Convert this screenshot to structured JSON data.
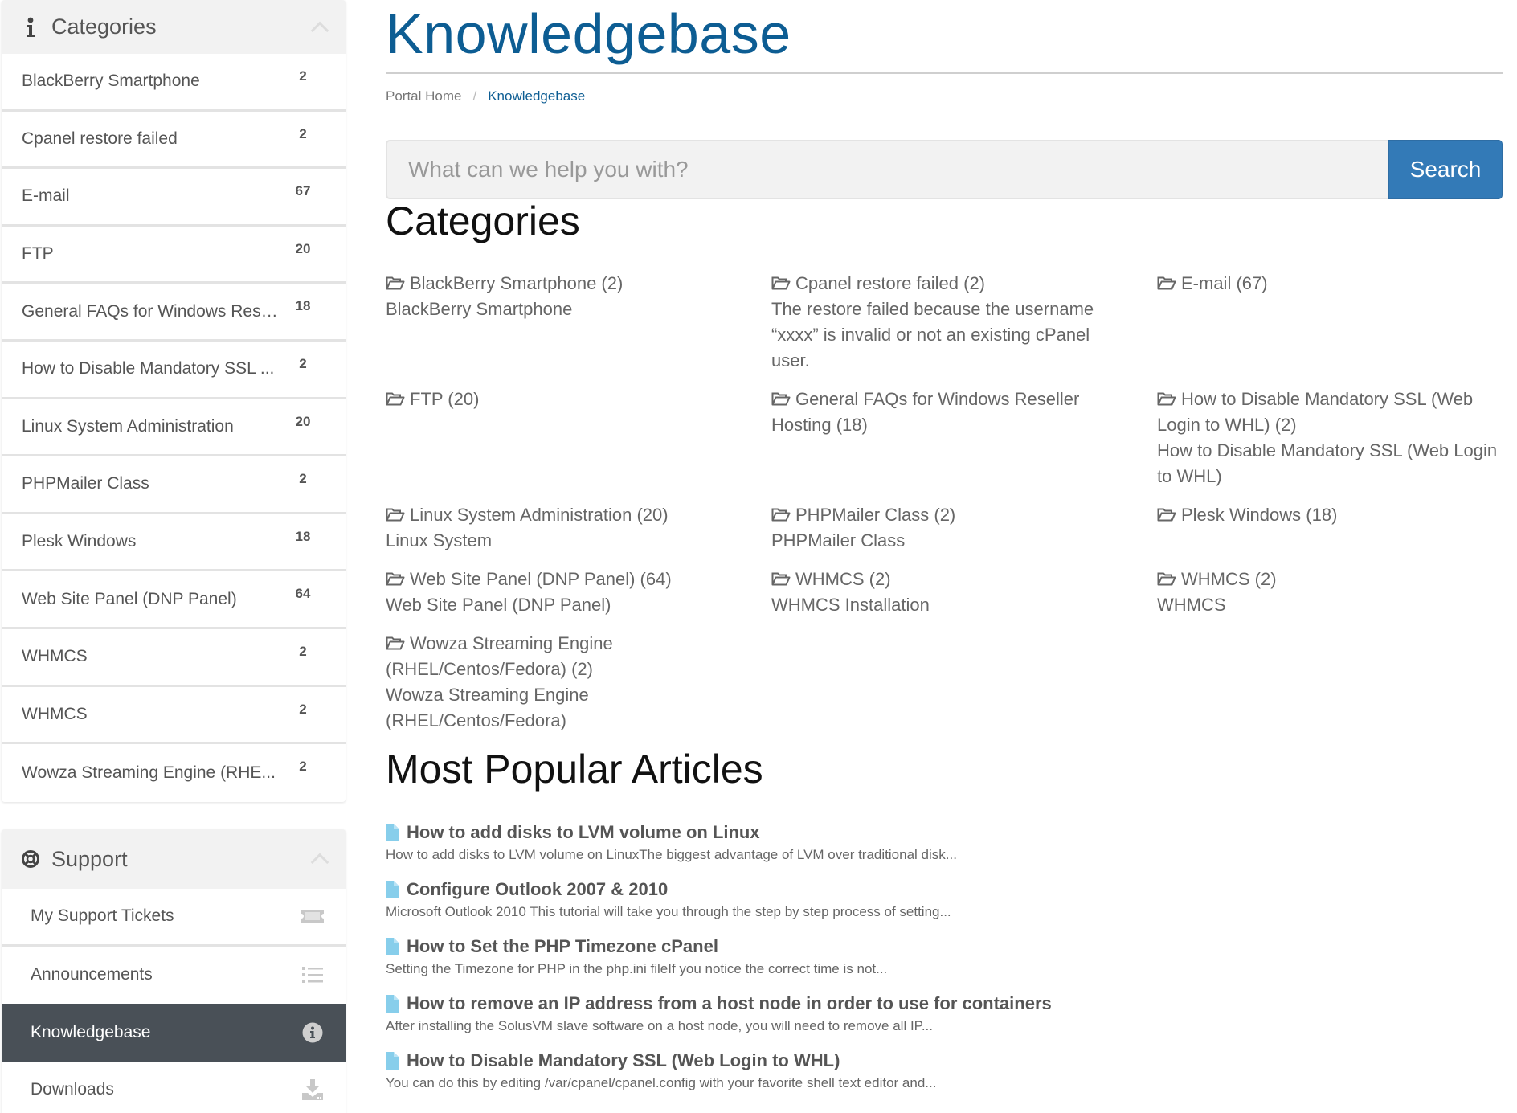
{
  "sidebar": {
    "categories_panel": {
      "title": "Categories",
      "icon": "info-icon",
      "items": [
        {
          "label": "BlackBerry Smartphone",
          "count": "2"
        },
        {
          "label": "Cpanel restore failed",
          "count": "2"
        },
        {
          "label": "E-mail",
          "count": "67"
        },
        {
          "label": "FTP",
          "count": "20"
        },
        {
          "label": "General FAQs for Windows Rese...",
          "count": "18"
        },
        {
          "label": "How to Disable Mandatory SSL ...",
          "count": "2"
        },
        {
          "label": "Linux System Administration",
          "count": "20"
        },
        {
          "label": "PHPMailer Class",
          "count": "2"
        },
        {
          "label": "Plesk Windows",
          "count": "18"
        },
        {
          "label": "Web Site Panel (DNP Panel)",
          "count": "64"
        },
        {
          "label": "WHMCS",
          "count": "2"
        },
        {
          "label": "WHMCS",
          "count": "2"
        },
        {
          "label": "Wowza Streaming Engine (RHE...",
          "count": "2"
        }
      ]
    },
    "support_panel": {
      "title": "Support",
      "icon": "life-ring-icon",
      "items": [
        {
          "label": "My Support Tickets",
          "icon": "ticket-icon",
          "active": false
        },
        {
          "label": "Announcements",
          "icon": "list-icon",
          "active": false
        },
        {
          "label": "Knowledgebase",
          "icon": "info-circle-icon",
          "active": true
        },
        {
          "label": "Downloads",
          "icon": "download-icon",
          "active": false
        }
      ]
    }
  },
  "main": {
    "title": "Knowledgebase",
    "breadcrumb": [
      {
        "label": "Portal Home"
      },
      {
        "label": "Knowledgebase",
        "active": true
      }
    ],
    "breadcrumb_separator": "/",
    "search": {
      "placeholder": "What can we help you with?",
      "value": "",
      "button_label": "Search"
    },
    "categories_heading": "Categories",
    "categories": [
      {
        "title": "BlackBerry Smartphone (2)",
        "description": "BlackBerry Smartphone"
      },
      {
        "title": "Cpanel restore failed (2)",
        "description": "The restore failed because the username “xxxx” is invalid or not an existing cPanel user."
      },
      {
        "title": "E-mail (67)",
        "description": ""
      },
      {
        "title": "FTP (20)",
        "description": ""
      },
      {
        "title": "General FAQs for Windows Reseller Hosting (18)",
        "description": ""
      },
      {
        "title": "How to Disable Mandatory SSL (Web Login to WHL) (2)",
        "description": "How to Disable Mandatory SSL (Web Login to WHL)"
      },
      {
        "title": "Linux System Administration (20)",
        "description": "Linux System"
      },
      {
        "title": "PHPMailer Class (2)",
        "description": "PHPMailer Class"
      },
      {
        "title": "Plesk Windows (18)",
        "description": ""
      },
      {
        "title": "Web Site Panel (DNP Panel) (64)",
        "description": "Web Site Panel (DNP Panel)"
      },
      {
        "title": "WHMCS (2)",
        "description": "WHMCS Installation"
      },
      {
        "title": "WHMCS (2)",
        "description": "WHMCS"
      },
      {
        "title": "Wowza Streaming Engine (RHEL/Centos/Fedora) (2)",
        "description": "Wowza Streaming Engine (RHEL/Centos/Fedora)"
      }
    ],
    "popular_heading": "Most Popular Articles",
    "articles": [
      {
        "title": "How to add disks to LVM volume on Linux",
        "excerpt": "How to add disks to LVM volume on LinuxThe biggest advantage of LVM over traditional disk..."
      },
      {
        "title": "Configure Outlook 2007 & 2010",
        "excerpt": "Microsoft Outlook 2010 This tutorial will take you through the step by step process of setting..."
      },
      {
        "title": "How to Set the PHP Timezone cPanel",
        "excerpt": "Setting the Timezone for PHP in the php.ini fileIf you notice the correct time is not..."
      },
      {
        "title": "How to remove an IP address from a host node in order to use for containers",
        "excerpt": "After installing the SolusVM slave software on a host node, you will need to remove all IP..."
      },
      {
        "title": "How to Disable Mandatory SSL (Web Login to WHL)",
        "excerpt": "You can do this by editing /var/cpanel/cpanel.config with your favorite shell text editor and..."
      }
    ]
  },
  "colors": {
    "brand_blue": "#0d5d93",
    "button_blue": "#337ab7",
    "active_nav_bg": "#495057",
    "doc_icon": "#87ceeb"
  }
}
